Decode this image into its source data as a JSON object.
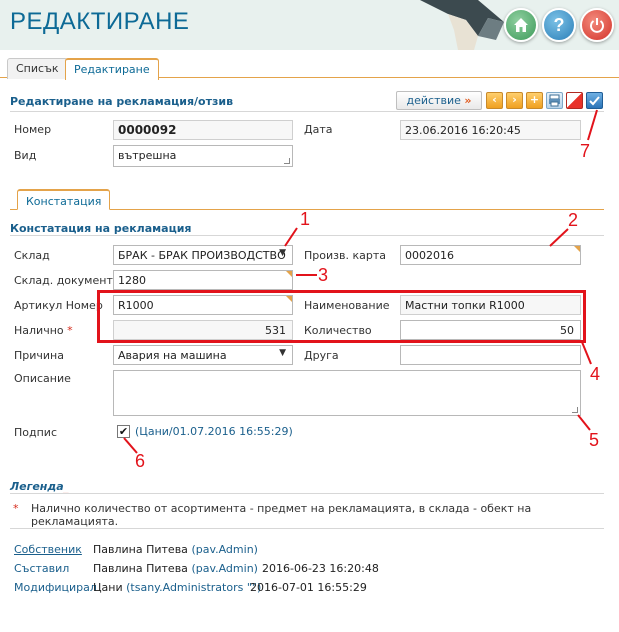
{
  "app": {
    "title": "РЕДАКТИРАНЕ",
    "help_glyph": "?"
  },
  "tabs": [
    {
      "label": "Списък"
    },
    {
      "label": "Редактиране"
    }
  ],
  "form": {
    "title": "Редактиране на рекламация/отзив",
    "action_label": "действие",
    "action_arrow": "»",
    "nomer_label": "Номер",
    "nomer_value": "0000092",
    "data_label": "Дата",
    "data_value": "23.06.2016 16:20:45",
    "vid_label": "Вид",
    "vid_value": "вътрешна"
  },
  "inner_tab": {
    "label": "Констатация"
  },
  "constatation": {
    "title": "Констатация на рекламация",
    "sklad_label": "Склад",
    "sklad_value": "БРАК - БРАК ПРОИЗВОДСТВО",
    "proizv_label": "Произв. карта",
    "proizv_value": "0002016",
    "doc_label": "Склад. документ",
    "doc_value": "1280",
    "artikul_label": "Артикул Номер",
    "artikul_value": "R1000",
    "naimen_label": "Наименование",
    "naimen_value": "Мастни топки R1000",
    "nalichno_label": "Налично",
    "required_mark": "*",
    "nalichno_value": "531",
    "kolichestvo_label": "Количество",
    "kolichestvo_value": "50",
    "prichina_label": "Причина",
    "prichina_value": "Авария на машина",
    "druga_label": "Друга",
    "druga_value": "",
    "opisanie_label": "Описание",
    "opisanie_value": "",
    "podpis_label": "Подпис",
    "podpis_checked": true,
    "podpis_text": "(Цани/01.07.2016 16:55:29)"
  },
  "legend": {
    "title": "Легенда",
    "dash": "_",
    "star": "*",
    "text": "Налично количество от асортимента - предмет на рекламацията, в склада - обект на рекламацията."
  },
  "meta": {
    "owner_label": "Собственик",
    "owner_name": "Павлина Питева",
    "owner_account": "(pav.Admin)",
    "creator_label": "Съставил",
    "creator_name": "Павлина Питева",
    "creator_account": "(pav.Admin)",
    "creator_date": "2016-06-23 16:20:48",
    "modifier_label": "Модифицирал",
    "modifier_name": "Цани",
    "modifier_account": "(tsany.Administrators \"\")",
    "modifier_date": "2016-07-01 16:55:29"
  },
  "annotations": {
    "n1": "1",
    "n2": "2",
    "n3": "3",
    "n4": "4",
    "n5": "5",
    "n6": "6",
    "n7": "7"
  },
  "colors": {
    "accent": "#0d6a96",
    "tab_border": "#e4a34a",
    "annotation": "#e2131b"
  }
}
